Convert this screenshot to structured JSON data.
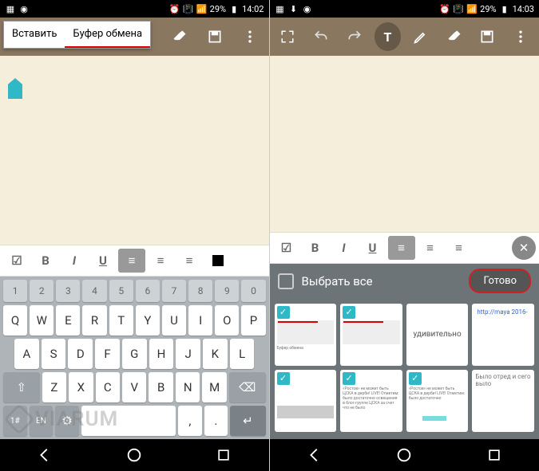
{
  "left": {
    "status": {
      "battery": "29%",
      "time": "14:02"
    },
    "context_menu": {
      "paste": "Вставить",
      "clipboard": "Буфер обмена"
    },
    "format": {
      "bold": "B",
      "italic": "I",
      "underline": "U"
    },
    "kb": {
      "nums": [
        "1",
        "2",
        "3",
        "4",
        "5",
        "6",
        "7",
        "8",
        "9",
        "0"
      ],
      "r1": [
        "Q",
        "W",
        "E",
        "R",
        "T",
        "Y",
        "U",
        "I",
        "O",
        "P"
      ],
      "r2": [
        "A",
        "S",
        "D",
        "F",
        "G",
        "H",
        "J",
        "K",
        "L"
      ],
      "r3": [
        "Z",
        "X",
        "C",
        "V",
        "B",
        "N",
        "M"
      ],
      "sym": "1#",
      "lang": "EN",
      "comma": ",",
      "dot": "."
    }
  },
  "right": {
    "status": {
      "battery": "29%",
      "time": "14:03"
    },
    "format": {
      "bold": "B",
      "italic": "I",
      "underline": "U"
    },
    "clip": {
      "select_all": "Выбрать все",
      "done": "Готово",
      "items": [
        {
          "checked": true,
          "preview": "screenshot"
        },
        {
          "checked": true,
          "preview": "screenshot"
        },
        {
          "checked": false,
          "text": "удивительно"
        },
        {
          "checked": false,
          "text": "http://maya 2016-"
        },
        {
          "checked": true,
          "preview": "screenshot"
        },
        {
          "checked": true,
          "preview": "text-block"
        },
        {
          "checked": true,
          "preview": "text-block"
        },
        {
          "checked": false,
          "text": "Было отред и сего выло"
        }
      ]
    }
  },
  "watermark": "VIARUM"
}
